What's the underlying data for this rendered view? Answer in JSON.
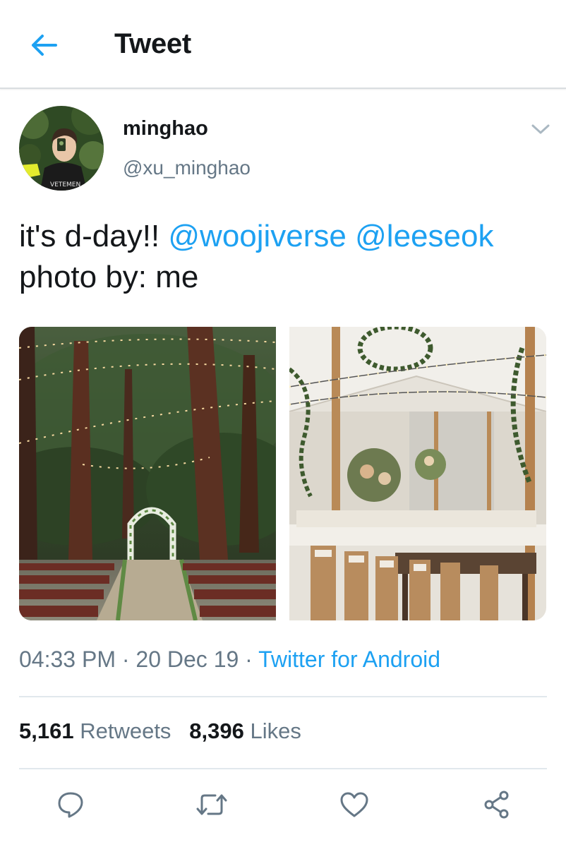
{
  "header": {
    "title": "Tweet",
    "back_icon": "arrow-left-icon"
  },
  "author": {
    "display_name": "minghao",
    "handle": "@xu_minghao",
    "avatar_shirt_text": "VETEMEN"
  },
  "tweet": {
    "text_before": "it's d-day!! ",
    "mention_1": "@woojiverse",
    "text_between": " ",
    "mention_2": "@leeseok",
    "line_2": "photo by: me"
  },
  "media": [
    {
      "description_name": "forest-wedding-ceremony-photo"
    },
    {
      "description_name": "tent-wedding-reception-photo"
    }
  ],
  "meta": {
    "time": "04:33 PM",
    "separator_1": " · ",
    "date": "20 Dec 19",
    "separator_2": " · ",
    "source": "Twitter for Android"
  },
  "stats": {
    "retweets_count": "5,161",
    "retweets_label": "Retweets",
    "likes_count": "8,396",
    "likes_label": "Likes"
  },
  "actions": [
    "reply-icon",
    "retweet-icon",
    "like-icon",
    "share-icon"
  ],
  "colors": {
    "accent": "#1da1f2",
    "secondary_text": "#657786",
    "primary_text": "#14171a",
    "divider": "#e1e8ed"
  }
}
